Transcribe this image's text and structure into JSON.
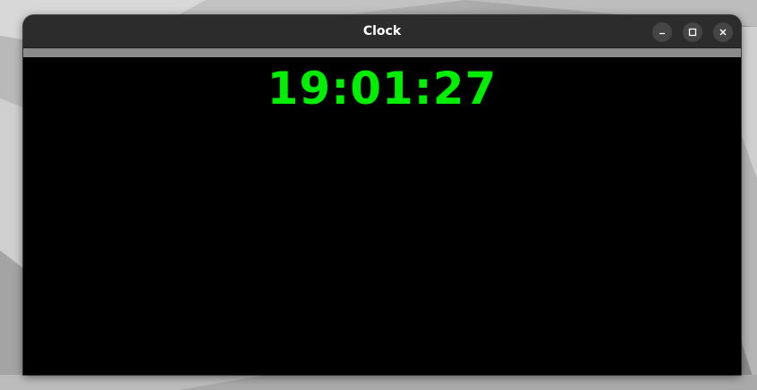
{
  "window": {
    "title": "Clock"
  },
  "titlebar_buttons": {
    "minimize_icon": "minimize-icon",
    "maximize_icon": "maximize-icon",
    "close_icon": "close-icon"
  },
  "clock": {
    "time": "19:01:27",
    "color": "#00ee00",
    "background": "#000000"
  }
}
